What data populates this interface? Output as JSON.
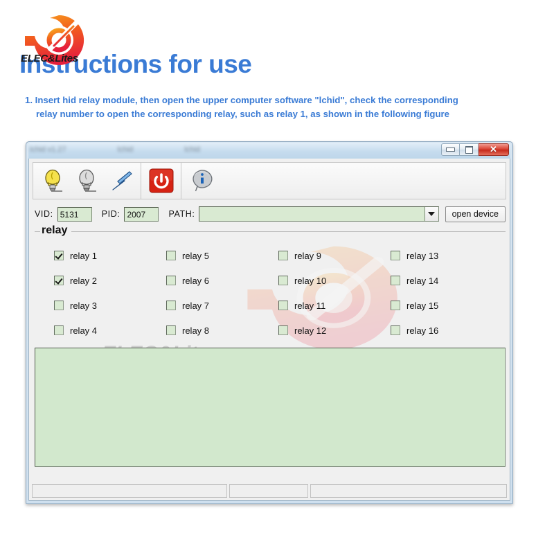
{
  "brand": {
    "logo_icon": "elec-lites-target-swoosh-logo",
    "wordmark": "ELEC&Lites",
    "logo_color_start": "#f5a623",
    "logo_color_end": "#e8253a"
  },
  "header": {
    "title": "Instructions for use",
    "title_color": "#3a7bd5",
    "instructions": [
      "1. Insert hid relay module, then open the upper computer software \"lchid\", check the corresponding",
      "relay number to open the corresponding relay, such as relay 1, as shown in the following figure"
    ]
  },
  "window": {
    "title_text": "",
    "title_blur_segments": [
      "",
      "",
      ""
    ],
    "buttons": {
      "minimize": "minimize-button",
      "maximize": "maximize-button",
      "close_label": "✕"
    }
  },
  "toolbar": {
    "groups": [
      {
        "items": [
          {
            "icon": "lightbulb-on-icon",
            "label": ""
          },
          {
            "icon": "lightbulb-off-icon",
            "label": ""
          },
          {
            "icon": "blue-flash-icon",
            "label": ""
          }
        ]
      },
      {
        "items": [
          {
            "icon": "power-button-icon",
            "label": ""
          }
        ]
      },
      {
        "items": [
          {
            "icon": "info-bubble-icon",
            "label": ""
          }
        ]
      }
    ]
  },
  "device_row": {
    "vid_label": "VID:",
    "vid_value": "5131",
    "pid_label": "PID:",
    "pid_value": "2007",
    "path_label": "PATH:",
    "path_value": "",
    "path_placeholder": "",
    "dropdown_icon": "chevron-down-icon",
    "open_device_label": "open device"
  },
  "relay_panel": {
    "legend": "relay",
    "items": [
      {
        "label": "relay 1",
        "checked": true
      },
      {
        "label": "relay 5",
        "checked": false
      },
      {
        "label": "relay 9",
        "checked": false
      },
      {
        "label": "relay 13",
        "checked": false
      },
      {
        "label": "relay 2",
        "checked": true
      },
      {
        "label": "relay 6",
        "checked": false
      },
      {
        "label": "relay 10",
        "checked": false
      },
      {
        "label": "relay 14",
        "checked": false
      },
      {
        "label": "relay 3",
        "checked": false
      },
      {
        "label": "relay 7",
        "checked": false
      },
      {
        "label": "relay 11",
        "checked": false
      },
      {
        "label": "relay 15",
        "checked": false
      },
      {
        "label": "relay 4",
        "checked": false
      },
      {
        "label": "relay 8",
        "checked": false
      },
      {
        "label": "relay 12",
        "checked": false
      },
      {
        "label": "relay 16",
        "checked": false
      }
    ]
  },
  "log_area": {
    "value": "",
    "background_color": "#d2e8cd"
  },
  "status_bar": {
    "panels": [
      "",
      "",
      ""
    ]
  },
  "watermark": {
    "icon": "elec-lites-watermark-logo",
    "text": "ELEC&Lites"
  }
}
